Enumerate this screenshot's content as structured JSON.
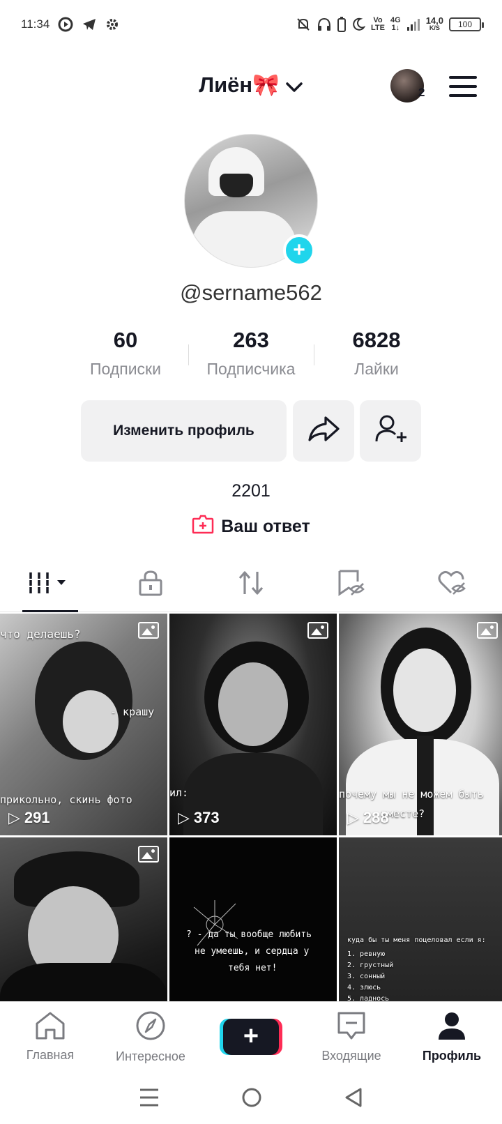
{
  "status_bar": {
    "time": "11:34",
    "network_label_top": "Vo",
    "network_label_bottom": "LTE",
    "signal_label_top": "4G",
    "signal_label_bottom": "1↓",
    "speed_value": "14,0",
    "speed_unit": "K/S",
    "battery": "100"
  },
  "header": {
    "display_name": "Лиён🎀",
    "account_count": "2"
  },
  "profile": {
    "handle": "@sername562",
    "stats": [
      {
        "value": "60",
        "label": "Подписки"
      },
      {
        "value": "263",
        "label": "Подписчика"
      },
      {
        "value": "6828",
        "label": "Лайки"
      }
    ],
    "edit_button_label": "Изменить профиль",
    "bio": "2201",
    "answer_label": "Ваш ответ"
  },
  "tabs": [
    "videos",
    "private",
    "reposts",
    "favorites",
    "liked"
  ],
  "grid": [
    {
      "views": "291",
      "overlay_top": "что делаешь?",
      "overlay_mid": "- крашу",
      "overlay_bottom": "прикольно, скинь фото"
    },
    {
      "views": "373",
      "overlay_bottom": "ил:"
    },
    {
      "views": "288",
      "overlay_bottom": "почему мы не можем быть",
      "overlay_bottom2": "вместе?"
    },
    {
      "views": ""
    },
    {
      "views": "",
      "overlay_line1": "? - да ты вообще любить",
      "overlay_line2": "не умеешь, и сердца у",
      "overlay_line3": "тебя нет!"
    },
    {
      "views": "",
      "overlay_line1": "куда бы ты меня поцеловал если я:",
      "list": [
        "1. ревную",
        "2. грустный",
        "3. сонный",
        "4. злюсь",
        "5. ладнось"
      ]
    }
  ],
  "bottom_nav": {
    "home": "Главная",
    "discover": "Интересное",
    "inbox": "Входящие",
    "profile": "Профиль"
  },
  "colors": {
    "accent_cyan": "#20d5ec",
    "accent_red": "#fe2c55",
    "text_primary": "#161823",
    "text_secondary": "#8a8b91"
  }
}
